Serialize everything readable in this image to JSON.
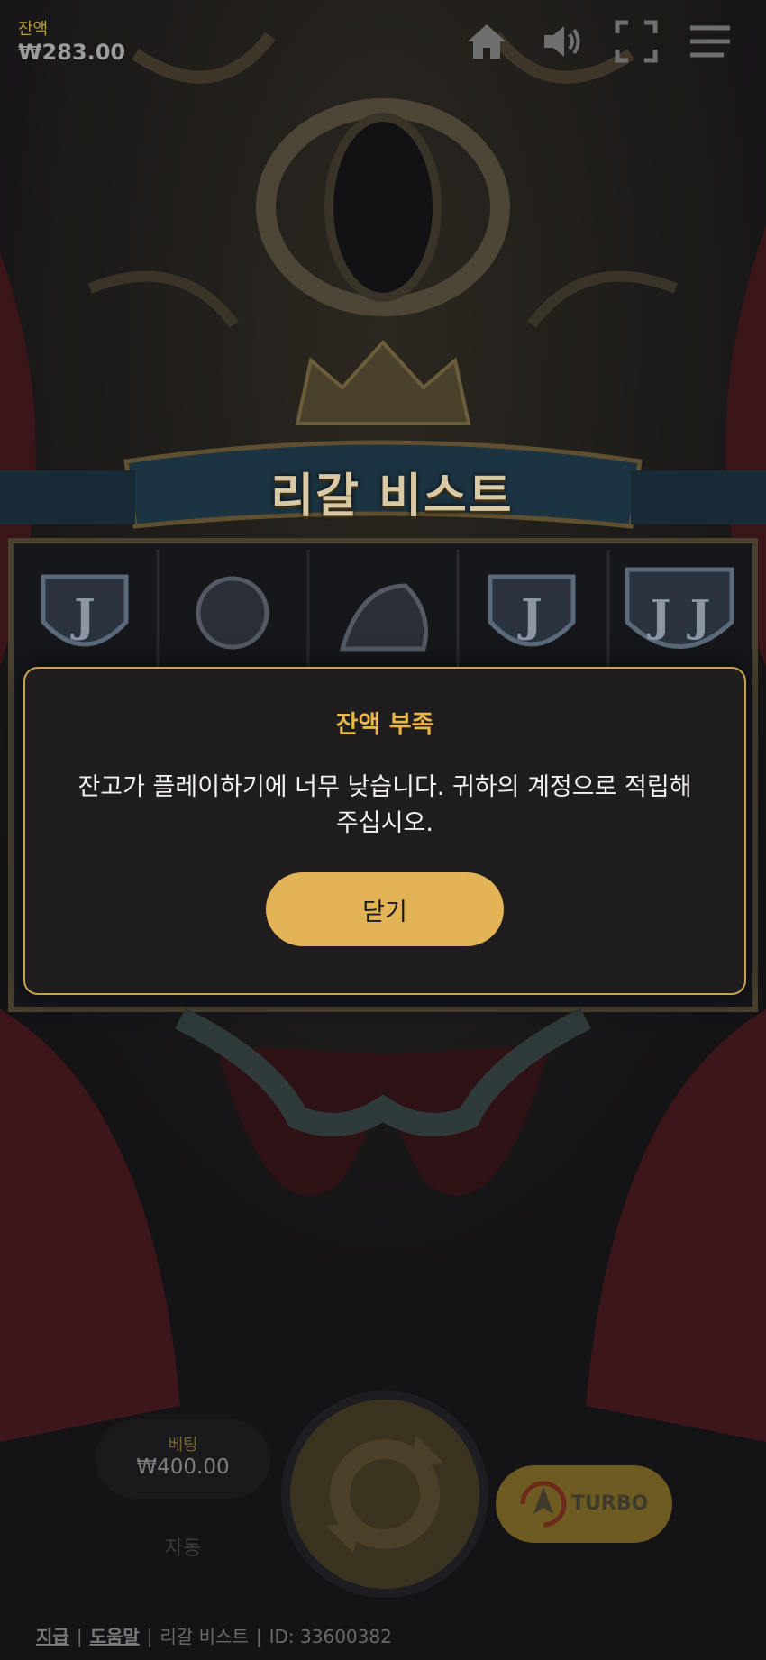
{
  "hud": {
    "balance_label": "잔액",
    "balance_value": "₩283.00",
    "icons": [
      "home-icon",
      "sound-icon",
      "fullscreen-icon",
      "menu-icon"
    ]
  },
  "game": {
    "title": "리갈 비스트"
  },
  "modal": {
    "title": "잔액 부족",
    "message_line1": "잔고가 플레이하기에 너무 낮습니다. 귀하의 계정으로 적립해",
    "message_line2": "주십시오.",
    "close_label": "닫기"
  },
  "controls": {
    "bet_label": "베팅",
    "bet_value": "₩400.00",
    "auto_label": "자동",
    "turbo_label": "TURBO"
  },
  "footer": {
    "pay_link": "지급",
    "help_link": "도움말",
    "game_name": "리갈 비스트",
    "id_text": "ID: 33600382"
  },
  "colors": {
    "accent_gold": "#e2b457",
    "modal_title": "#e8b94a",
    "modal_border": "#c9a24f"
  }
}
